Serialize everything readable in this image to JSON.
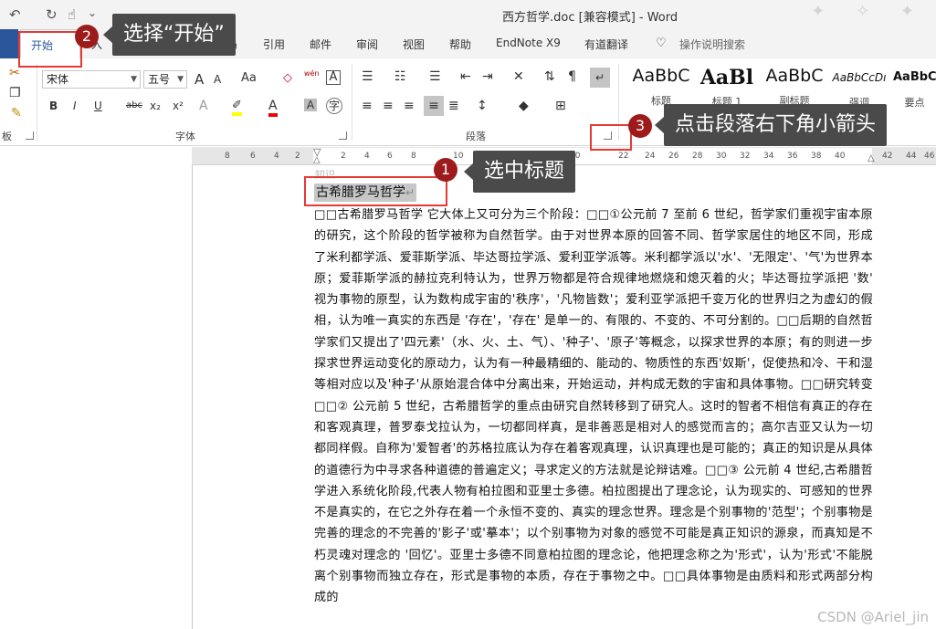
{
  "titlebar": {
    "undo_glyph": "↶",
    "redo_glyph": "↻",
    "touch_glyph": "☝",
    "more_glyph": "⌄",
    "title": "西方哲学.doc [兼容模式] - Word",
    "birds": "✦ ✧ ✦"
  },
  "tabs": {
    "home": "开始",
    "insert": "入",
    "draw": "绘",
    "design": "设计",
    "layout": "布局",
    "references": "引用",
    "mailings": "邮件",
    "review": "审阅",
    "view": "视图",
    "help": "帮助",
    "endnote": "EndNote X9",
    "translate": "有道翻译",
    "tellme": "操作说明搜索"
  },
  "ribbon": {
    "clipboard_label": "板",
    "font_group_label": "字体",
    "paragraph_group_label": "段落",
    "styles_group_label": "样式",
    "font_name": "宋体",
    "font_size": "五号",
    "grow": "A",
    "shrink": "A",
    "case": "Aa",
    "pinyin": "wén",
    "bold": "B",
    "italic": "I",
    "underline": "U",
    "strike": "abc",
    "sub": "x₂",
    "sup": "x²",
    "styles": [
      {
        "sample": "AaBbC",
        "name": "标题"
      },
      {
        "sample": "AaBl",
        "name": "标题 1"
      },
      {
        "sample": "AaBbC",
        "name": "副标题"
      },
      {
        "sample": "AaBbCcDı",
        "name": "强调"
      },
      {
        "sample": "AaBbCc",
        "name": "要点"
      }
    ]
  },
  "ruler": {
    "numbers": [
      "8",
      "6",
      "4",
      "2",
      "2",
      "4",
      "6",
      "8",
      "10",
      "12",
      "14",
      "16",
      "18",
      "20",
      "22",
      "24",
      "26",
      "28",
      "30",
      "32",
      "34",
      "36",
      "38",
      "40",
      "42",
      "44",
      "46",
      "48"
    ]
  },
  "document": {
    "heading": "古希腊罗马哲学",
    "paragraph_mark": "↵",
    "faint_line": "知识",
    "body": "□□古希腊罗马哲学 它大体上又可分为三个阶段：□□①公元前 7 至前 6 世纪，哲学家们重视宇宙本原的研究，这个阶段的哲学被称为自然哲学。由于对世界本原的回答不同、哲学家居住的地区不同，形成了米利都学派、爱菲斯学派、毕达哥拉学派、爱利亚学派等。米利都学派以'水'、'无限定'、'气'为世界本原；爱菲斯学派的赫拉克利特认为，世界万物都是符合规律地燃烧和熄灭着的火；毕达哥拉学派把 '数' 视为事物的原型，认为数构成宇宙的'秩序'，'凡物皆数'；爱利亚学派把千变万化的世界归之为虚幻的假相，认为唯一真实的东西是 '存在'，'存在' 是单一的、有限的、不变的、不可分割的。□□后期的自然哲学家们又提出了'四元素'（水、火、土、气）、'种子'、'原子'等概念，以探求世界的本原；有的则进一步探求世界运动变化的原动力，认为有一种最精细的、能动的、物质性的东西'奴斯'，促使热和冷、干和湿等相对应以及'种子'从原始混合体中分离出来，开始运动，并构成无数的宇宙和具体事物。□□研究转变 □□② 公元前 5 世纪，古希腊哲学的重点由研究自然转移到了研究人。这时的智者不相信有真正的存在和客观真理，普罗泰戈拉认为，一切都同样真，是非善恶是相对人的感觉而言的；高尔吉亚又认为一切都同样假。自称为'爱智者'的苏格拉底认为存在着客观真理，认识真理也是可能的；真正的知识是从具体的道德行为中寻求各种道德的普遍定义；寻求定义的方法就是论辩诘难。□□③ 公元前 4 世纪,古希腊哲学进入系统化阶段,代表人物有柏拉图和亚里士多德。柏拉图提出了理念论，认为现实的、可感知的世界不是真实的，在它之外存在着一个永恒不变的、真实的理念世界。理念是个别事物的'范型'；个别事物是完善的理念的不完善的'影子'或'摹本'；以个别事物为对象的感觉不可能是真正知识的源泉，而真知是不朽灵魂对理念的 '回忆'。亚里士多德不同意柏拉图的理念论，他把理念称之为'形式'，认为'形式'不能脱离个别事物而独立存在，形式是事物的本质，存在于事物之中。□□具体事物是由质料和形式两部分构成的"
  },
  "annotations": [
    {
      "num": "1",
      "text": "选中标题"
    },
    {
      "num": "2",
      "text": "选择“开始”"
    },
    {
      "num": "3",
      "text": "点击段落右下角小箭头"
    }
  ],
  "watermark": "CSDN @Ariel_jin"
}
